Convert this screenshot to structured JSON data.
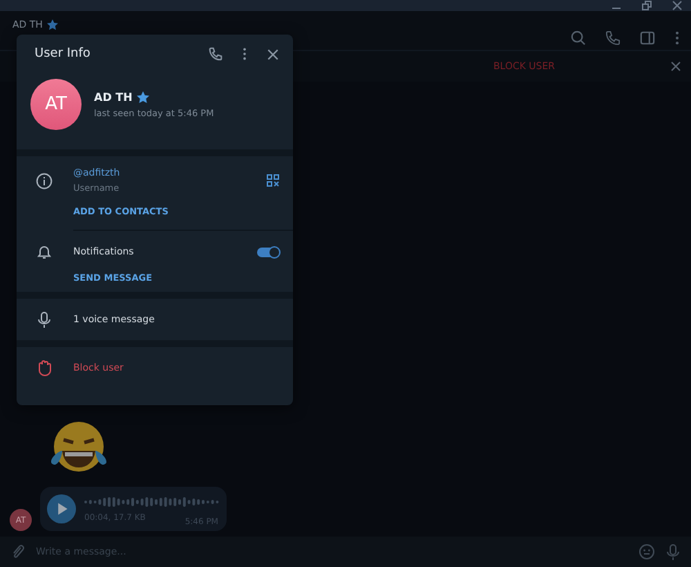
{
  "chat": {
    "name": "AD TH",
    "starred": true,
    "block_label": "BLOCK USER",
    "voice": {
      "meta": "00:04, 17.7 KB",
      "time": "5:46 PM",
      "avatar": "AT"
    },
    "composer": {
      "placeholder": "Write a message..."
    }
  },
  "user_info": {
    "title": "User Info",
    "avatar": "AT",
    "name": "AD TH",
    "starred": true,
    "status": "last seen today at 5:46 PM",
    "username": "@adfitzth",
    "username_label": "Username",
    "add_contact": "ADD TO CONTACTS",
    "notifications": {
      "label": "Notifications",
      "on": true
    },
    "send_message": "SEND MESSAGE",
    "media": "1 voice message",
    "block": "Block user"
  }
}
